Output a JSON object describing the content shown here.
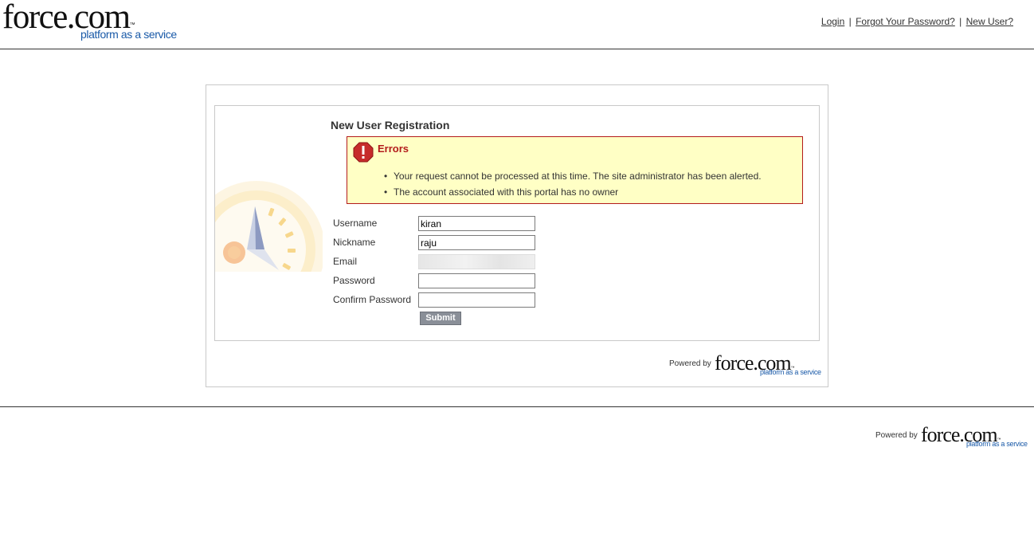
{
  "header": {
    "logo": {
      "word": "force.com",
      "tm": "™",
      "tagline": "platform as a service"
    },
    "links": {
      "login": "Login",
      "forgot": "Forgot Your Password?",
      "new_user": "New User?",
      "separator": "|"
    }
  },
  "registration": {
    "title": "New User Registration",
    "errors": {
      "title": "Errors",
      "icon": "error-exclamation-icon",
      "items": [
        "Your request cannot be processed at this time. The site administrator has been alerted.",
        "The account associated with this portal has no owner"
      ]
    },
    "fields": {
      "username": {
        "label": "Username",
        "value": "kiran"
      },
      "nickname": {
        "label": "Nickname",
        "value": "raju"
      },
      "email": {
        "label": "Email",
        "value": ""
      },
      "password": {
        "label": "Password",
        "value": ""
      },
      "confirm_password": {
        "label": "Confirm Password",
        "value": ""
      }
    },
    "submit_label": "Submit"
  },
  "powered_by": {
    "text": "Powered by",
    "logo_word": "force.com",
    "tm": "™",
    "tagline": "platform as a service"
  },
  "colors": {
    "error_border": "#b31b1b",
    "error_bg": "#ffffc5",
    "brand_blue": "#1a5aa8",
    "button_bg": "#8a8f98"
  }
}
